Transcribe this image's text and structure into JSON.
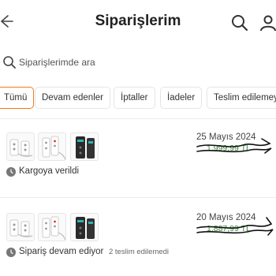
{
  "header": {
    "title": "Siparişlerim",
    "back_icon": "arrow-left-icon",
    "search_icon": "search-icon",
    "user_icon": "user-icon"
  },
  "search": {
    "placeholder": "Siparişlerimde ara"
  },
  "tabs": [
    {
      "label": "Tümü",
      "active": true
    },
    {
      "label": "Devam edenler",
      "active": false
    },
    {
      "label": "İptaller",
      "active": false
    },
    {
      "label": "İadeler",
      "active": false
    },
    {
      "label": "Teslim edilemeyenler",
      "active": false
    }
  ],
  "orders": [
    {
      "date": "25 Mayıs 2024",
      "price": "1.999,99 TL",
      "status": "Kargoya verildi",
      "status_note": ""
    },
    {
      "date": "20 Mayıs 2024",
      "price": "1.887,99 TL",
      "status": "Sipariş devam ediyor",
      "status_note": "2 teslim edilemedi"
    }
  ],
  "colors": {
    "accent": "#f27a1a",
    "price_green": "#3a8a3a",
    "scribble": "#111111"
  }
}
